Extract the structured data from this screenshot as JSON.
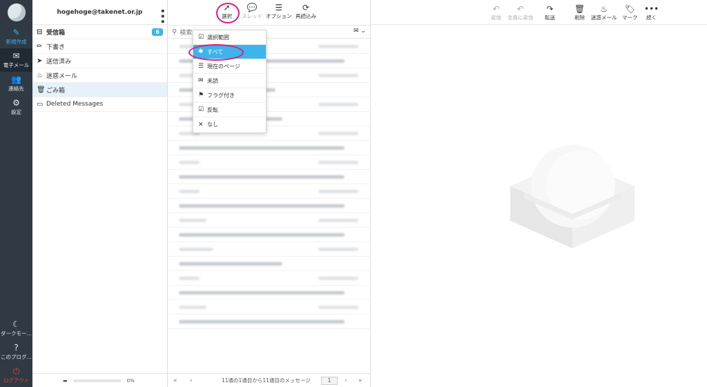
{
  "nav": {
    "compose": "新規作成",
    "mail": "電子メール",
    "contacts": "連絡先",
    "settings": "設定",
    "darkmode": "ダークモー…",
    "about": "このプログ…",
    "logout": "ログアウト"
  },
  "account": "hogehoge@takenet.or.jp",
  "folders": [
    {
      "label": "受信箱",
      "icon": "inbox-icon",
      "badge": "6"
    },
    {
      "label": "下書き",
      "icon": "pencil-icon"
    },
    {
      "label": "送信済み",
      "icon": "send-icon"
    },
    {
      "label": "迷惑メール",
      "icon": "fire-icon"
    },
    {
      "label": "ごみ箱",
      "icon": "trash-icon"
    },
    {
      "label": "Deleted Messages",
      "icon": "folder-icon"
    }
  ],
  "quota": "0%",
  "list_toolbar": {
    "select": "選択",
    "threads": "スレッド",
    "options": "オプション",
    "refresh": "再読込み"
  },
  "search": {
    "placeholder": "検索"
  },
  "select_menu": [
    {
      "label": "選択範囲",
      "icon": "checkbox-icon"
    },
    {
      "label": "すべて",
      "icon": "asterisk-icon",
      "highlighted": true
    },
    {
      "label": "現在のページ",
      "icon": "lines-icon"
    },
    {
      "label": "未読",
      "icon": "envelope-icon"
    },
    {
      "label": "フラグ付き",
      "icon": "flag-icon"
    },
    {
      "label": "反転",
      "icon": "checked-box-icon"
    },
    {
      "label": "なし",
      "icon": "x-icon"
    }
  ],
  "pager": {
    "text": "11通の1通目から11通目のメッセージ",
    "page": "1"
  },
  "viewer_toolbar": {
    "reply": "返信",
    "reply_all": "全員に返信",
    "forward": "転送",
    "delete": "削除",
    "spam": "迷惑メール",
    "mark": "マーク",
    "more": "続く"
  },
  "colors": {
    "accent": "#3db4ea",
    "nav_bg": "#2f3a44",
    "annotation": "#e0197d",
    "logout": "#e3423c"
  }
}
